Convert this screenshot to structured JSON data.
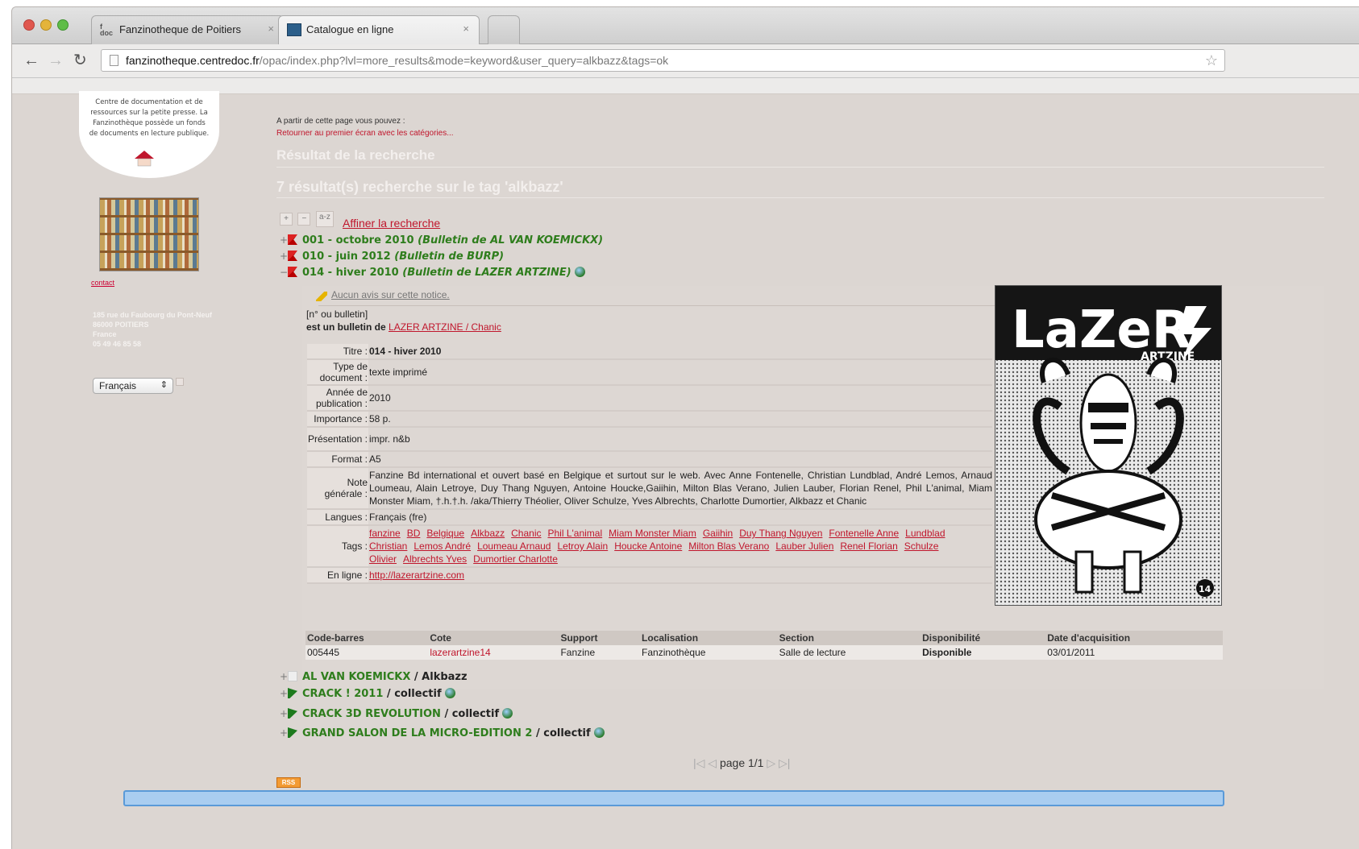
{
  "browser": {
    "tabs": [
      {
        "label": "Fanzinotheque de Poitiers",
        "icon": "fdoc-favicon"
      },
      {
        "label": "Catalogue en ligne",
        "icon": "catalogue-favicon"
      }
    ],
    "url_host": "fanzinotheque.centredoc.fr",
    "url_path": "/opac/index.php?lvl=more_results&mode=keyword&user_query=alkbazz&tags=ok"
  },
  "sidebar": {
    "logo_text": "Centre de documentation et de ressources sur la petite presse. La Fanzinothèque possède un fonds de documents en lecture publique.",
    "small_link": "contact",
    "address_lines": [
      "185 rue du Faubourg du Pont-Neuf",
      "86000 POITIERS",
      "France",
      "05 49 46 85 58"
    ],
    "language": "Français"
  },
  "main": {
    "intro": "A partir de cette page vous pouvez :",
    "back_link": "Retourner au premier écran avec les catégories...",
    "heading": "Résultat de la recherche",
    "count_heading": "7 résultat(s) recherche sur le tag 'alkbazz'",
    "refine": "Affiner la recherche",
    "results_top": [
      {
        "title": "001 - octobre 2010",
        "parent": "(Bulletin de AL VAN KOEMICKX)",
        "toggle": "+"
      },
      {
        "title": "010 - juin 2012",
        "parent": "(Bulletin de BURP)",
        "toggle": "+"
      },
      {
        "title": "014 - hiver 2010",
        "parent": "(Bulletin de LAZER ARTZINE)",
        "toggle": "−"
      }
    ],
    "detail": {
      "avis": "Aucun avis sur cette notice.",
      "no_bulletin": "[n° ou bulletin]",
      "bulletin_of_label": "est un bulletin de",
      "bulletin_of_link": "LAZER ARTZINE / Chanic",
      "fields": [
        {
          "label": "Titre :",
          "value": "014 - hiver 2010"
        },
        {
          "label": "Type de document :",
          "value": "texte imprimé"
        },
        {
          "label": "Année de publication :",
          "value": "2010"
        },
        {
          "label": "Importance :",
          "value": "58 p."
        },
        {
          "label": "Présentation :",
          "value": "impr. n&b"
        },
        {
          "label": "Format :",
          "value": "A5"
        },
        {
          "label": "Note générale :",
          "value": "Fanzine Bd international et ouvert basé en Belgique et surtout sur le web. Avec Anne Fontenelle, Christian Lundblad, André Lemos, Arnaud Loumeau, Alain Letroye, Duy Thang Nguyen, Antoine Houcke,Gaiihin, Milton Blas Verano, Julien Lauber, Florian Renel, Phil L'animal, Miam Monster Miam, †.h.†.h. /aka/Thierry Théolier, Oliver Schulze, Yves Albrechts, Charlotte Dumortier, Alkbazz et Chanic"
        },
        {
          "label": "Langues :",
          "value": "Français (fre)"
        }
      ],
      "tags_label": "Tags :",
      "tags": [
        "fanzine",
        "BD",
        "Belgique",
        "Alkbazz",
        "Chanic",
        "Phil L'animal",
        "Miam Monster Miam",
        "Gaiihin",
        "Duy Thang Nguyen",
        "Fontenelle Anne",
        "Lundblad Christian",
        "Lemos André",
        "Loumeau Arnaud",
        "Letroy Alain",
        "Houcke Antoine",
        "Milton Blas Verano",
        "Lauber Julien",
        "Renel Florian",
        "Schulze Olivier",
        "Albrechts Yves",
        "Dumortier Charlotte"
      ],
      "online_label": "En ligne :",
      "online_link": "http://lazerartzine.com",
      "cover_title": "LaZeR",
      "cover_subtitle": "ARTZINE",
      "cover_number": "14"
    },
    "items_table": {
      "headers": [
        "Code-barres",
        "Cote",
        "Support",
        "Localisation",
        "Section",
        "Disponibilité",
        "Date d'acquisition"
      ],
      "row": [
        "005445",
        "lazerartzine14",
        "Fanzine",
        "Fanzinothèque",
        "Salle de lecture",
        "Disponible",
        "03/01/2011"
      ]
    },
    "results_bottom": [
      {
        "title": "AL VAN KOEMICKX",
        "author": "Alkbazz",
        "globe": false
      },
      {
        "title": "CRACK ! 2011",
        "author": "collectif",
        "globe": true
      },
      {
        "title": "CRACK 3D REVOLUTION",
        "author": "collectif",
        "globe": true
      },
      {
        "title": "GRAND SALON DE LA MICRO-EDITION 2",
        "author": "collectif",
        "globe": true
      }
    ],
    "pager": "page 1/1",
    "rss": "RSS"
  }
}
